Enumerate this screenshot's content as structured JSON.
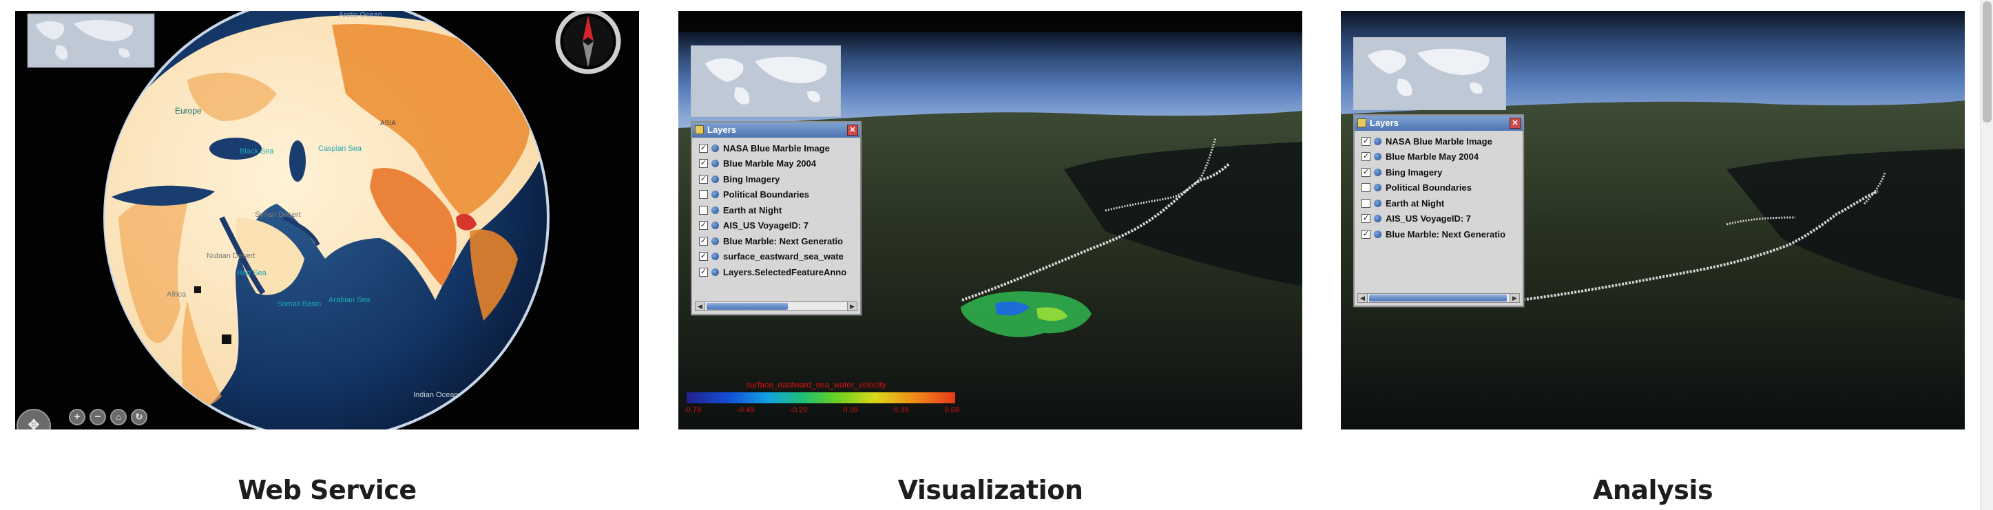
{
  "panels": [
    {
      "caption": "Web Service",
      "labels": {
        "arctic": "Arctic Ocean",
        "europe": "Europe",
        "asia": "ASIA",
        "black_sea": "Black Sea",
        "caspian": "Caspian Sea",
        "syrian": "Syrian Desert",
        "nubian": "Nubian Desert",
        "red_sea": "Red Sea",
        "africa": "Africa",
        "arabian": "Arabian Sea",
        "somali": "Somali Basin",
        "indian": "Indian Ocean"
      },
      "controls": [
        "+",
        "−",
        "⌂",
        "↻"
      ]
    },
    {
      "caption": "Visualization",
      "layers_title": "Layers",
      "layers": [
        {
          "checked": true,
          "label": "NASA Blue Marble Image"
        },
        {
          "checked": true,
          "label": "Blue Marble May 2004"
        },
        {
          "checked": true,
          "label": "Bing Imagery"
        },
        {
          "checked": false,
          "label": "Political Boundaries"
        },
        {
          "checked": false,
          "label": "Earth at Night"
        },
        {
          "checked": true,
          "label": "AIS_US VoyageID: 7"
        },
        {
          "checked": true,
          "label": "Blue Marble: Next Generatio"
        },
        {
          "checked": true,
          "label": "surface_eastward_sea_wate"
        },
        {
          "checked": true,
          "label": "Layers.SelectedFeatureAnno"
        }
      ],
      "colorbar": {
        "title": "surface_eastward_sea_water_velocity",
        "ticks": [
          "-0.78",
          "-0.49",
          "-0.20",
          "0.09",
          "0.39",
          "0.68"
        ]
      }
    },
    {
      "caption": "Analysis",
      "layers_title": "Layers",
      "layers": [
        {
          "checked": true,
          "label": "NASA Blue Marble Image"
        },
        {
          "checked": true,
          "label": "Blue Marble May 2004"
        },
        {
          "checked": true,
          "label": "Bing Imagery"
        },
        {
          "checked": false,
          "label": "Political Boundaries"
        },
        {
          "checked": false,
          "label": "Earth at Night"
        },
        {
          "checked": true,
          "label": "AIS_US VoyageID: 7"
        },
        {
          "checked": true,
          "label": "Blue Marble: Next Generatio"
        }
      ]
    }
  ],
  "colors": {
    "accent_title": "#4d75b0",
    "caption_text": "#1d1d1d",
    "land_orange": "#e98a2c",
    "ocean": "#0f2a52"
  },
  "icons": [
    "compass-icon",
    "zoom-in-icon",
    "zoom-out-icon",
    "home-icon",
    "refresh-icon",
    "globe-icon",
    "close-icon",
    "pan-icon"
  ]
}
